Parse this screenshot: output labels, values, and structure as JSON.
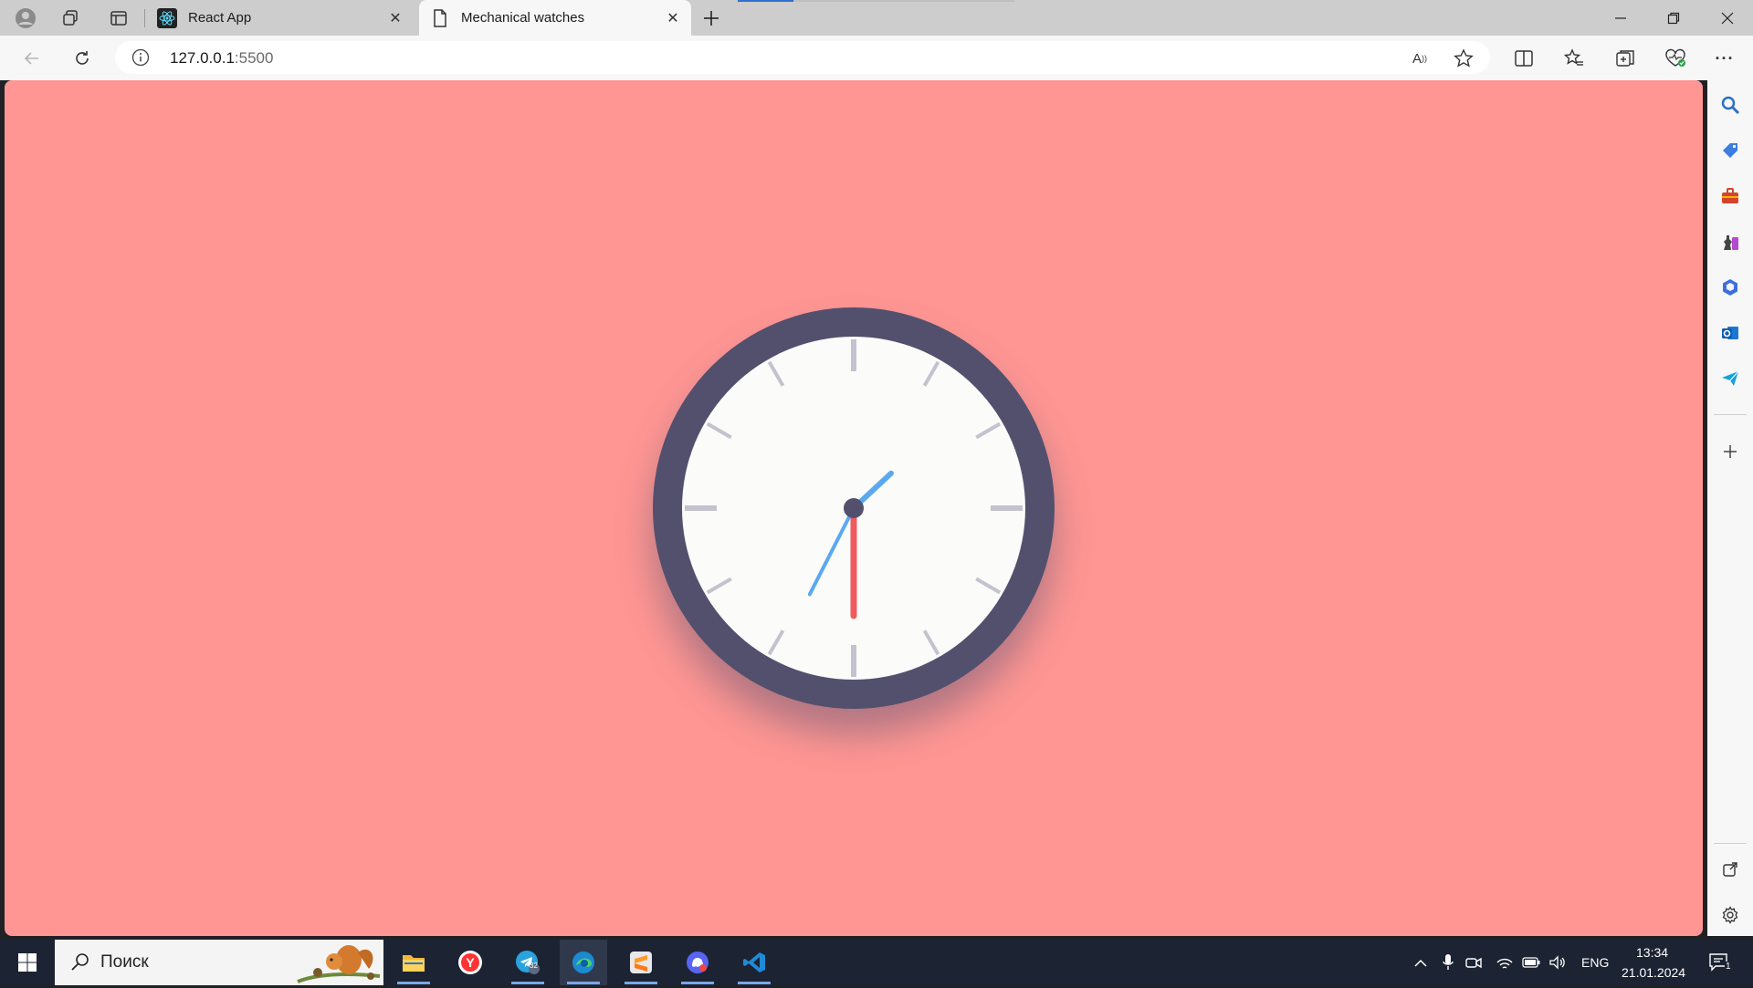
{
  "browser": {
    "tabs": [
      {
        "title": "React App",
        "favicon": "react-icon",
        "active": false
      },
      {
        "title": "Mechanical watches",
        "favicon": "page-icon",
        "active": true
      }
    ],
    "address": {
      "host": "127.0.0.1",
      "port": ":5500"
    },
    "load_progress": 0.2
  },
  "page": {
    "background": "#ff9693",
    "clock": {
      "rim_color": "#53506e",
      "face_color": "#fbfbf9",
      "tick_color": "#c4c2ce",
      "hour_hand_color": "#5aa9f0",
      "minute_hand_color": "#5aa9f0",
      "second_hand_color": "#f05a5e",
      "time": {
        "hours": 1,
        "minutes": 34,
        "seconds": 30
      }
    }
  },
  "sidebar": {
    "icons": [
      "search-icon",
      "shopping-tag-icon",
      "tools-icon",
      "games-icon",
      "copilot-icon",
      "outlook-icon",
      "send-icon",
      "add-icon",
      "open-external-icon",
      "settings-icon"
    ]
  },
  "taskbar": {
    "search_label": "Поиск",
    "apps": [
      "file-explorer-icon",
      "yandex-browser-icon",
      "telegram-icon",
      "edge-icon",
      "sublime-icon",
      "discord-icon",
      "vscode-icon"
    ],
    "telegram_badge": "32",
    "language": "ENG",
    "time": "13:34",
    "date": "21.01.2024",
    "notifications": "1"
  }
}
